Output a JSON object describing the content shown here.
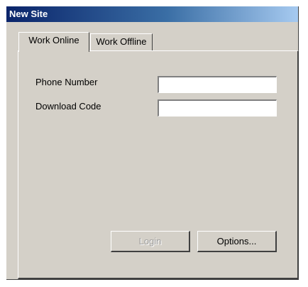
{
  "window": {
    "title": "New Site"
  },
  "tabs": [
    {
      "label": "Work Online",
      "active": true
    },
    {
      "label": "Work Offline",
      "active": false
    }
  ],
  "form": {
    "phone_label": "Phone Number",
    "phone_value": "",
    "download_label": "Download Code",
    "download_value": ""
  },
  "buttons": {
    "login_label": "Login",
    "login_disabled": true,
    "options_label": "Options..."
  }
}
